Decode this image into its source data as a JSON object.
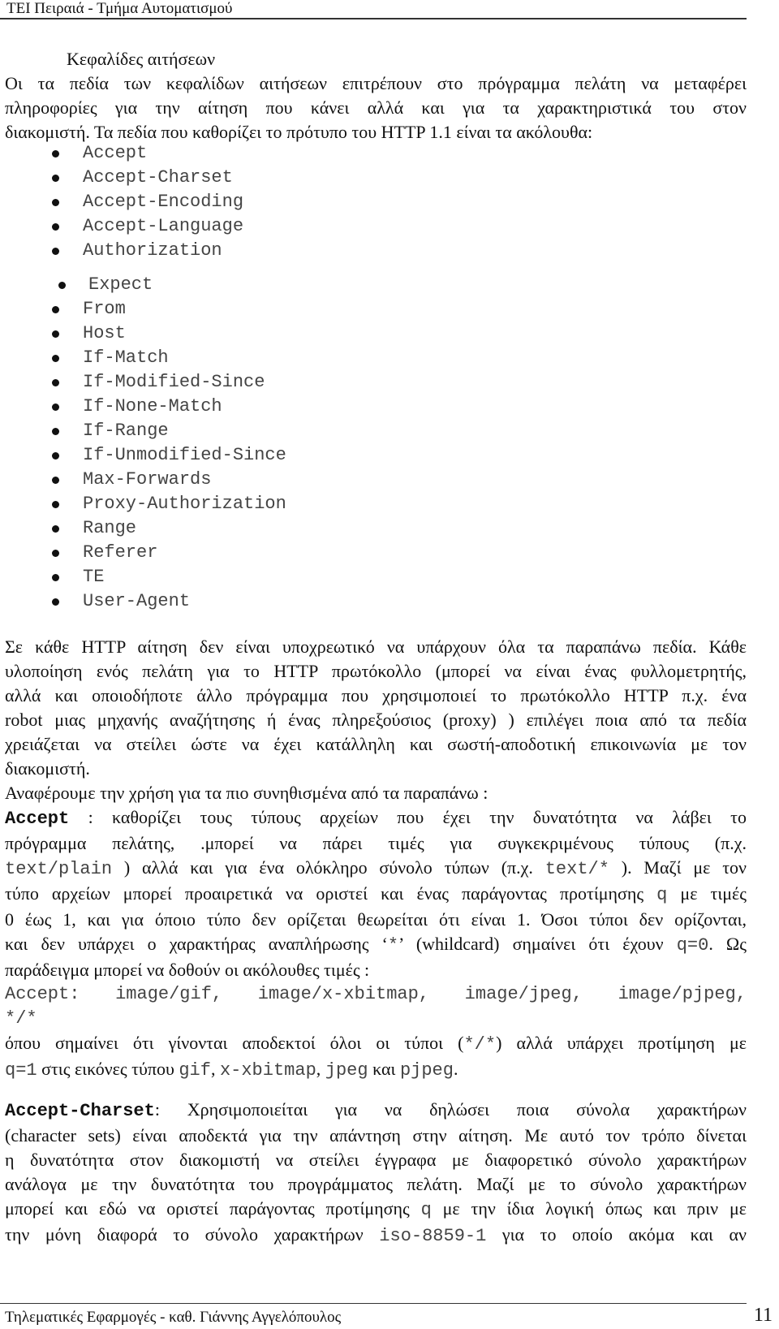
{
  "header": {
    "title": "ΤΕΙ Πειραιά - Τμήμα Αυτοματισμού"
  },
  "section": {
    "heading": "Κεφαλίδες αιτήσεων"
  },
  "intro": {
    "lines": [
      "Οι τα πεδία των κεφαλίδων αιτήσεων επιτρέπουν στο πρόγραμμα πελάτη να μεταφέρει",
      "πληροφορίες για την αίτηση που κάνει αλλά και για τα χαρακτηριστικά του στον",
      "διακομιστή. Τα πεδία που καθορίζει το πρότυπο του HTTP 1.1 είναι τα ακόλουθα:"
    ]
  },
  "fields_group1": [
    "Accept",
    "Accept-Charset",
    "Accept-Encoding",
    "Accept-Language",
    "Authorization"
  ],
  "fields_group2": [
    "Expect",
    "From",
    "Host",
    "If-Match",
    "If-Modified-Since",
    "If-None-Match",
    "If-Range",
    "If-Unmodified-Since",
    "Max-Forwards",
    "Proxy-Authorization",
    "Range",
    "Referer",
    "TE",
    "User-Agent"
  ],
  "para1": {
    "lines": [
      "Σε κάθε HTTP αίτηση δεν είναι υποχρεωτικό να υπάρχουν όλα τα παραπάνω πεδία. Κάθε",
      "υλοποίηση ενός πελάτη για το HTTP πρωτόκολλο (μπορεί να είναι ένας φυλλομετρητής,",
      "αλλά και οποιοδήποτε άλλο πρόγραμμα που χρησιμοποιεί το πρωτόκολλο HTTP π.χ. ένα",
      "robot μιας μηχανής αναζήτησης ή ένας πληρεξούσιος (proxy) ) επιλέγει ποια από τα πεδία",
      "χρειάζεται να στείλει ώστε να έχει κατάλληλη και σωστή-αποδοτική επικοινωνία με τον",
      "διακομιστή.",
      "Αναφέρουμε την χρήση για τα πιο συνηθισμένα από τα παραπάνω :"
    ]
  },
  "accept": {
    "term": "Accept",
    "l1": " : καθορίζει τους τύπους αρχείων που έχει την δυνατότητα να λάβει το",
    "l2": "πρόγραμμα πελάτης, .μπορεί να πάρει τιμές για συγκεκριμένους τύπους (π.χ.",
    "l3_code1": "text/plain",
    "l3_text1": " ) αλλά και για ένα ολόκληρο σύνολο τύπων (π.χ. ",
    "l3_code2": "text/*",
    "l3_text2": " ). Μαζί με τον",
    "l4_text1": "τύπο αρχείων μπορεί προαιρετικά να οριστεί και ένας παράγοντας προτίμησης ",
    "l4_code": "q",
    "l4_text2": " με τιμές",
    "l5": "0 έως 1, και για όποιο τύπο δεν ορίζεται θεωρείται ότι είναι 1. Όσοι τύποι δεν ορίζονται,",
    "l6_text1": "και δεν υπάρχει ο χαρακτήρας αναπλήρωσης ‘",
    "l6_code1": "*",
    "l6_text2": "’ (whildcard) σημαίνει ότι έχουν ",
    "l6_code2": "q=0",
    "l6_text3": ". Ως",
    "l7": "παράδειγμα μπορεί να δοθούν οι ακόλουθες τιμές :",
    "example_l1": "Accept: image/gif, image/x-xbitmap, image/jpeg, image/pjpeg,",
    "example_l2": "*/*",
    "l8_text1": "όπου σημαίνει ότι γίνονται αποδεκτοί όλοι οι τύποι (",
    "l8_code": "*/*",
    "l8_text2": ") αλλά υπάρχει προτίμηση με",
    "l9_code1": "q=1",
    "l9_text1": " στις εικόνες τύπου ",
    "l9_code2": "gif",
    "l9_text2": ", ",
    "l9_code3": "x-xbitmap",
    "l9_text3": ", ",
    "l9_code4": "jpeg",
    "l9_text4": " και ",
    "l9_code5": "pjpeg",
    "l9_text5": "."
  },
  "accept_charset": {
    "term": "Accept-Charset",
    "l1": ": Χρησιμοποιείται για να δηλώσει ποια σύνολα χαρακτήρων",
    "l2": "(character sets) είναι αποδεκτά για την απάντηση στην αίτηση. Με αυτό τον τρόπο δίνεται",
    "l3": "η δυνατότητα στον διακομιστή να στείλει έγγραφα με διαφορετικό σύνολο χαρακτήρων",
    "l4": "ανάλογα με την δυνατότητα του προγράμματος πελάτη. Μαζί με το σύνολο χαρακτήρων",
    "l5_text1": "μπορεί και εδώ να οριστεί παράγοντας προτίμησης ",
    "l5_code": "q",
    "l5_text2": " με την ίδια λογική όπως και πριν με",
    "l6_text1": "την μόνη διαφορά το σύνολο χαρακτήρων ",
    "l6_code": "iso-8859-1",
    "l6_text2": " για το οποίο ακόμα και αν"
  },
  "footer": {
    "text": "Τηλεματικές Εφαρμογές - καθ. Γιάννης Αγγελόπουλος",
    "page_number": "11"
  }
}
